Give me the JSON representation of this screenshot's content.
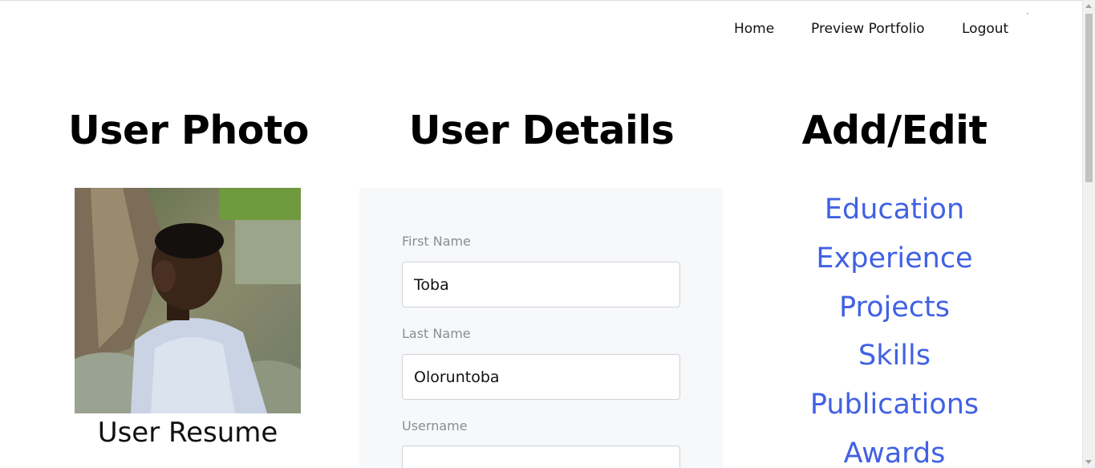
{
  "nav": {
    "home": "Home",
    "preview": "Preview Portfolio",
    "logout": "Logout"
  },
  "photo_section": {
    "title": "User Photo",
    "resume_link": "User Resume"
  },
  "details_section": {
    "title": "User Details",
    "fields": [
      {
        "label": "First Name",
        "value": "Toba"
      },
      {
        "label": "Last Name",
        "value": "Oloruntoba"
      },
      {
        "label": "Username",
        "value": ""
      }
    ]
  },
  "addedit_section": {
    "title": "Add/Edit",
    "links": [
      "Education",
      "Experience",
      "Projects",
      "Skills",
      "Publications",
      "Awards"
    ]
  },
  "colors": {
    "link_blue": "#4161e3",
    "panel_bg": "#f7f8fa",
    "label_gray": "#8a8d93"
  }
}
